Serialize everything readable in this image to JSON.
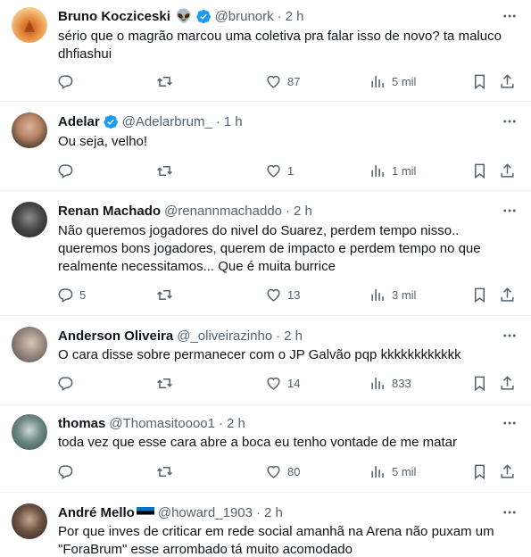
{
  "colors": {
    "text": "#0f1419",
    "muted": "#536471",
    "verified": "#1d9bf0",
    "divider": "#eff3f4"
  },
  "icons": {
    "reply": "reply-icon",
    "retweet": "retweet-icon",
    "like": "heart-icon",
    "views": "views-icon",
    "bookmark": "bookmark-icon",
    "share": "share-icon",
    "more": "more-icon",
    "verified": "verified-badge-icon"
  },
  "tweets": [
    {
      "name": "Bruno Kocziceski",
      "emoji": "👽",
      "verified": true,
      "handle": "@brunork",
      "time": "2 h",
      "text": "sério que o magrão marcou uma coletiva pra falar isso de novo? ta maluco\ndhfiashui",
      "replies": "",
      "retweets": "",
      "likes": "87",
      "views": "5 mil"
    },
    {
      "name": "Adelar",
      "emoji": "",
      "verified": true,
      "handle": "@Adelarbrum_",
      "time": "1 h",
      "text": "Ou seja, velho!",
      "replies": "",
      "retweets": "",
      "likes": "1",
      "views": "1 mil"
    },
    {
      "name": "Renan Machado",
      "emoji": "",
      "verified": false,
      "handle": "@renannmachaddo",
      "time": "2 h",
      "text": "Não queremos jogadores do nivel do Suarez, perdem tempo nisso..\nqueremos bons jogadores, querem de impacto e perdem tempo no que\nrealmente necessitamos... Que é muita burrice",
      "replies": "5",
      "retweets": "",
      "likes": "13",
      "views": "3 mil"
    },
    {
      "name": "Anderson Oliveira",
      "emoji": "",
      "verified": false,
      "handle": "@_oliveirazinho",
      "time": "2 h",
      "text": "O cara disse sobre permanecer com o JP Galvão pqp kkkkkkkkkkkk",
      "replies": "",
      "retweets": "",
      "likes": "14",
      "views": "833"
    },
    {
      "name": "thomas",
      "emoji": "",
      "verified": false,
      "handle": "@Thomasitoooo1",
      "time": "2 h",
      "text": "toda vez que esse cara abre a boca eu tenho vontade de me matar",
      "replies": "",
      "retweets": "",
      "likes": "80",
      "views": "5 mil"
    },
    {
      "name": "André Mello",
      "emoji": "🇪🇪",
      "verified": false,
      "handle": "@howard_1903",
      "time": "2 h",
      "text": "Por que inves de criticar em rede social amanhã na Arena não puxam um\n\"ForaBrum\" esse arrombado tá muito acomodado",
      "replies": "",
      "retweets": "",
      "likes": "",
      "views": ""
    }
  ]
}
